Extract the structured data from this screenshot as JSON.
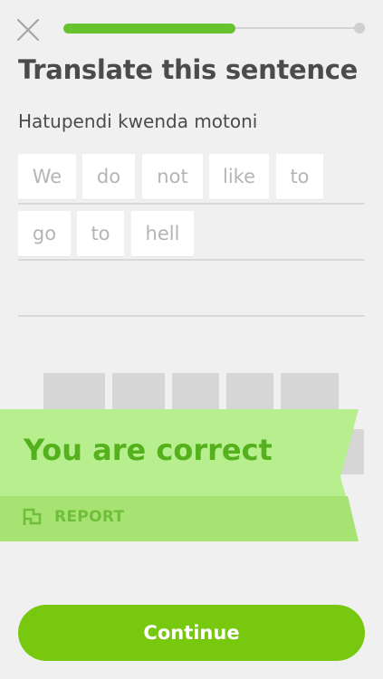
{
  "header": {
    "close_icon": "close-icon",
    "progress_fraction": 0.58,
    "progress_color": "#66c22e"
  },
  "exercise": {
    "title": "Translate this sentence",
    "prompt": "Hatupendi kwenda motoni",
    "answer_words": [
      "We",
      "do",
      "not",
      "like",
      "to",
      "go",
      "to",
      "hell"
    ]
  },
  "feedback": {
    "message": "You are correct",
    "report_label": "REPORT",
    "report_icon": "flag-icon",
    "banner_color": "#b8ef8e",
    "accent_color": "#54b01c"
  },
  "footer": {
    "continue_label": "Continue",
    "button_color": "#78c810"
  }
}
